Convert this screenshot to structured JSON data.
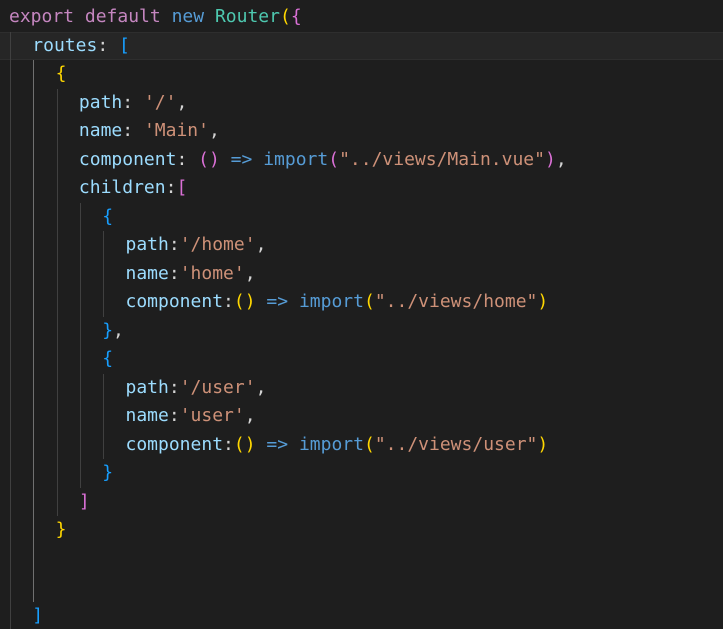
{
  "editor": {
    "theme_colors": {
      "background": "#1e1e1e",
      "keyword": "#569cd6",
      "control_keyword": "#c586c0",
      "class_name": "#4ec9b0",
      "property": "#9cdcfe",
      "string": "#ce9178",
      "function": "#dcdcaa",
      "default_text": "#d4d4d4",
      "bracket_gold": "#ffd700",
      "bracket_purple": "#da70d6",
      "bracket_blue": "#179fff"
    },
    "lines": [
      {
        "indent": 0,
        "tokens": [
          {
            "t": "export",
            "c": "#c586c0"
          },
          {
            "t": " ",
            "c": "#d4d4d4"
          },
          {
            "t": "default",
            "c": "#c586c0"
          },
          {
            "t": " ",
            "c": "#d4d4d4"
          },
          {
            "t": "new",
            "c": "#569cd6"
          },
          {
            "t": " ",
            "c": "#d4d4d4"
          },
          {
            "t": "Router",
            "c": "#4ec9b0"
          },
          {
            "t": "(",
            "c": "#ffd700"
          },
          {
            "t": "{",
            "c": "#da70d6"
          }
        ]
      },
      {
        "indent": 1,
        "tokens": [
          {
            "t": "routes",
            "c": "#9cdcfe"
          },
          {
            "t": ": ",
            "c": "#d4d4d4"
          },
          {
            "t": "[",
            "c": "#179fff"
          }
        ]
      },
      {
        "indent": 2,
        "tokens": [
          {
            "t": "{",
            "c": "#ffd700"
          }
        ]
      },
      {
        "indent": 3,
        "tokens": [
          {
            "t": "path",
            "c": "#9cdcfe"
          },
          {
            "t": ": ",
            "c": "#d4d4d4"
          },
          {
            "t": "'/'",
            "c": "#ce9178"
          },
          {
            "t": ",",
            "c": "#d4d4d4"
          }
        ]
      },
      {
        "indent": 3,
        "tokens": [
          {
            "t": "name",
            "c": "#9cdcfe"
          },
          {
            "t": ": ",
            "c": "#d4d4d4"
          },
          {
            "t": "'Main'",
            "c": "#ce9178"
          },
          {
            "t": ",",
            "c": "#d4d4d4"
          }
        ]
      },
      {
        "indent": 3,
        "tokens": [
          {
            "t": "component",
            "c": "#9cdcfe"
          },
          {
            "t": ": ",
            "c": "#d4d4d4"
          },
          {
            "t": "()",
            "c": "#da70d6"
          },
          {
            "t": " ",
            "c": "#d4d4d4"
          },
          {
            "t": "=>",
            "c": "#569cd6"
          },
          {
            "t": " ",
            "c": "#d4d4d4"
          },
          {
            "t": "import",
            "c": "#569cd6"
          },
          {
            "t": "(",
            "c": "#da70d6"
          },
          {
            "t": "\"../views/Main.vue\"",
            "c": "#ce9178"
          },
          {
            "t": ")",
            "c": "#da70d6"
          },
          {
            "t": ",",
            "c": "#d4d4d4"
          }
        ]
      },
      {
        "indent": 3,
        "tokens": [
          {
            "t": "children",
            "c": "#9cdcfe"
          },
          {
            "t": ":",
            "c": "#d4d4d4"
          },
          {
            "t": "[",
            "c": "#da70d6"
          }
        ]
      },
      {
        "indent": 4,
        "tokens": [
          {
            "t": "{",
            "c": "#179fff"
          }
        ]
      },
      {
        "indent": 5,
        "tokens": [
          {
            "t": "path",
            "c": "#9cdcfe"
          },
          {
            "t": ":",
            "c": "#d4d4d4"
          },
          {
            "t": "'/home'",
            "c": "#ce9178"
          },
          {
            "t": ",",
            "c": "#d4d4d4"
          }
        ]
      },
      {
        "indent": 5,
        "tokens": [
          {
            "t": "name",
            "c": "#9cdcfe"
          },
          {
            "t": ":",
            "c": "#d4d4d4"
          },
          {
            "t": "'home'",
            "c": "#ce9178"
          },
          {
            "t": ",",
            "c": "#d4d4d4"
          }
        ]
      },
      {
        "indent": 5,
        "tokens": [
          {
            "t": "component",
            "c": "#9cdcfe"
          },
          {
            "t": ":",
            "c": "#d4d4d4"
          },
          {
            "t": "()",
            "c": "#ffd700"
          },
          {
            "t": " ",
            "c": "#d4d4d4"
          },
          {
            "t": "=>",
            "c": "#569cd6"
          },
          {
            "t": " ",
            "c": "#d4d4d4"
          },
          {
            "t": "import",
            "c": "#569cd6"
          },
          {
            "t": "(",
            "c": "#ffd700"
          },
          {
            "t": "\"../views/home\"",
            "c": "#ce9178"
          },
          {
            "t": ")",
            "c": "#ffd700"
          }
        ]
      },
      {
        "indent": 4,
        "tokens": [
          {
            "t": "}",
            "c": "#179fff"
          },
          {
            "t": ",",
            "c": "#d4d4d4"
          }
        ]
      },
      {
        "indent": 4,
        "tokens": [
          {
            "t": "{",
            "c": "#179fff"
          }
        ]
      },
      {
        "indent": 5,
        "tokens": [
          {
            "t": "path",
            "c": "#9cdcfe"
          },
          {
            "t": ":",
            "c": "#d4d4d4"
          },
          {
            "t": "'/user'",
            "c": "#ce9178"
          },
          {
            "t": ",",
            "c": "#d4d4d4"
          }
        ]
      },
      {
        "indent": 5,
        "tokens": [
          {
            "t": "name",
            "c": "#9cdcfe"
          },
          {
            "t": ":",
            "c": "#d4d4d4"
          },
          {
            "t": "'user'",
            "c": "#ce9178"
          },
          {
            "t": ",",
            "c": "#d4d4d4"
          }
        ]
      },
      {
        "indent": 5,
        "tokens": [
          {
            "t": "component",
            "c": "#9cdcfe"
          },
          {
            "t": ":",
            "c": "#d4d4d4"
          },
          {
            "t": "()",
            "c": "#ffd700"
          },
          {
            "t": " ",
            "c": "#d4d4d4"
          },
          {
            "t": "=>",
            "c": "#569cd6"
          },
          {
            "t": " ",
            "c": "#d4d4d4"
          },
          {
            "t": "import",
            "c": "#569cd6"
          },
          {
            "t": "(",
            "c": "#ffd700"
          },
          {
            "t": "\"../views/user\"",
            "c": "#ce9178"
          },
          {
            "t": ")",
            "c": "#ffd700"
          }
        ]
      },
      {
        "indent": 4,
        "tokens": [
          {
            "t": "}",
            "c": "#179fff"
          }
        ]
      },
      {
        "indent": 3,
        "tokens": [
          {
            "t": "]",
            "c": "#da70d6"
          }
        ]
      },
      {
        "indent": 2,
        "tokens": [
          {
            "t": "}",
            "c": "#ffd700"
          }
        ]
      },
      {
        "indent": 0,
        "tokens": []
      },
      {
        "indent": 0,
        "tokens": []
      },
      {
        "indent": 1,
        "tokens": [
          {
            "t": "]",
            "c": "#179fff"
          }
        ]
      }
    ]
  }
}
